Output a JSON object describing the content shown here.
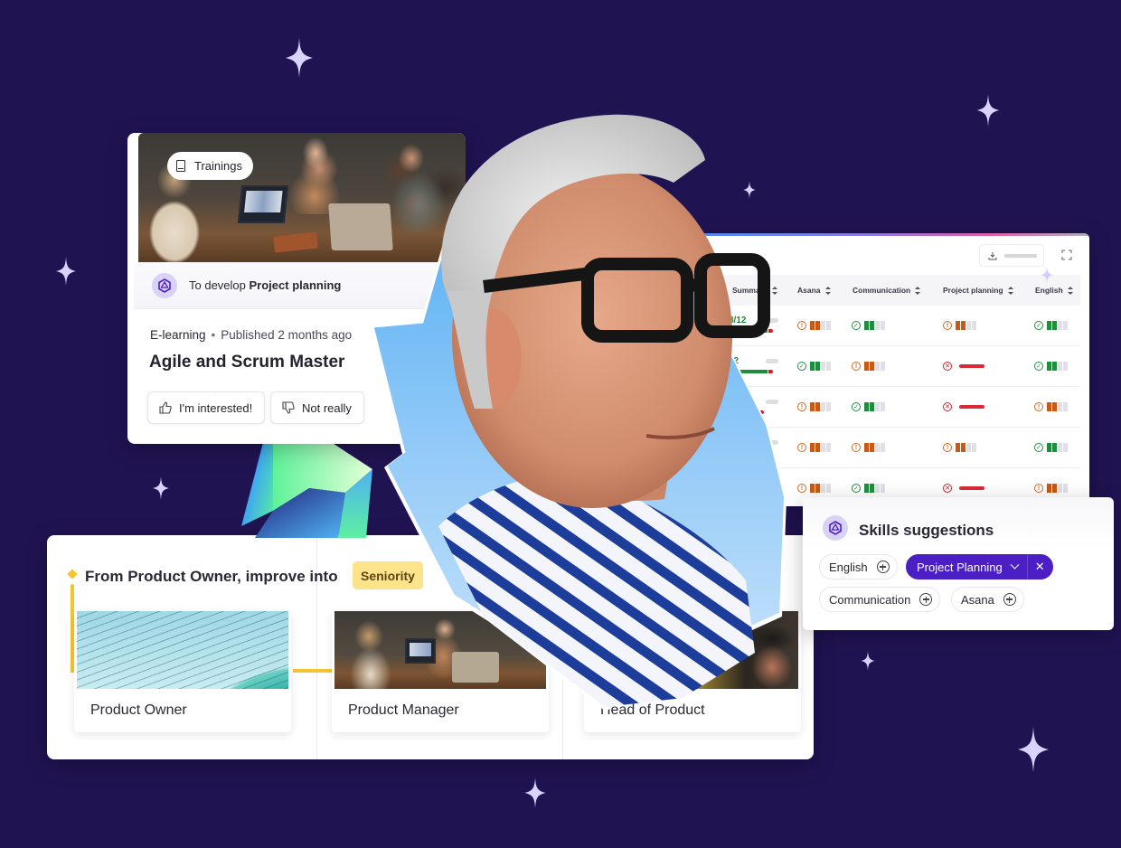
{
  "colors": {
    "background": "#201352",
    "accent_purple": "#4b1fc4",
    "success_green": "#1e8e3e",
    "warning_orange": "#c75a17",
    "danger_red": "#d92b35",
    "seniority_yellow": "#fde38a",
    "path_yellow": "#f5c431",
    "sparkle": "#d8d4ff"
  },
  "training_card": {
    "chip_label": "Trainings",
    "chip_icon": "book-icon",
    "develop_prefix": "To develop",
    "develop_skill": "Project planning",
    "type": "E-learning",
    "published": "Published 2 months ago",
    "title": "Agile and Scrum Master",
    "buttons": [
      {
        "label": "I'm interested!",
        "icon": "thumbs-up-icon"
      },
      {
        "label": "Not really",
        "icon": "thumbs-down-icon"
      }
    ]
  },
  "skills_table": {
    "columns": [
      "Summary",
      "Asana",
      "Communication",
      "Project planning",
      "English"
    ],
    "rows": [
      {
        "summary": "8/12",
        "summary_green": 0.8,
        "cells": [
          {
            "status": "warn",
            "level": 2
          },
          {
            "status": "ok",
            "level": 2
          },
          {
            "status": "warn",
            "level": 2
          },
          {
            "status": "ok",
            "level": 2
          }
        ]
      },
      {
        "summary": "12",
        "summary_green": 0.8,
        "cells": [
          {
            "status": "ok",
            "level": 2
          },
          {
            "status": "warn",
            "level": 2
          },
          {
            "status": "bad",
            "level": 0
          },
          {
            "status": "ok",
            "level": 2
          }
        ]
      },
      {
        "summary": "",
        "summary_green": 0.5,
        "cells": [
          {
            "status": "warn",
            "level": 2
          },
          {
            "status": "ok",
            "level": 2
          },
          {
            "status": "bad",
            "level": 0
          },
          {
            "status": "warn",
            "level": 2
          }
        ]
      },
      {
        "summary": "",
        "summary_green": 0.0,
        "cells": [
          {
            "status": "warn",
            "level": 2
          },
          {
            "status": "warn",
            "level": 2
          },
          {
            "status": "warn",
            "level": 2
          },
          {
            "status": "ok",
            "level": 2
          }
        ]
      },
      {
        "summary": "",
        "summary_green": 0.0,
        "cells": [
          {
            "status": "warn",
            "level": 2
          },
          {
            "status": "ok",
            "level": 2
          },
          {
            "status": "bad",
            "level": 0
          },
          {
            "status": "warn",
            "level": 2
          }
        ]
      }
    ],
    "status_glyphs": {
      "warn": "!",
      "ok": "✓",
      "bad": "✕"
    }
  },
  "skills_suggestions": {
    "title": "Skills suggestions",
    "chips": [
      {
        "label": "English",
        "selected": false
      },
      {
        "label": "Project Planning",
        "selected": true
      },
      {
        "label": "Communication",
        "selected": false
      },
      {
        "label": "Asana",
        "selected": false
      }
    ],
    "remove_glyph": "✕"
  },
  "career_path": {
    "title": "From Product Owner, improve into",
    "badge": "Seniority",
    "roles": [
      {
        "name": "Product Owner"
      },
      {
        "name": "Product Manager"
      },
      {
        "name": "Head of Product"
      }
    ]
  }
}
